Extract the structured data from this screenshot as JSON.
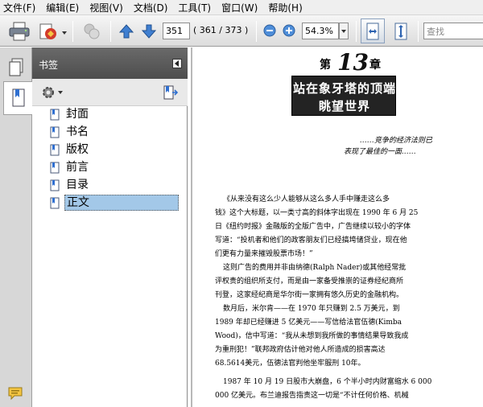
{
  "menu": [
    "文件(F)",
    "编辑(E)",
    "视图(V)",
    "文档(D)",
    "工具(T)",
    "窗口(W)",
    "帮助(H)"
  ],
  "toolbar": {
    "page_number": "351",
    "page_count": "( 361 / 373 )",
    "zoom": "54.3%",
    "search_placeholder": "查找"
  },
  "panel": {
    "title": "书签",
    "bookmarks": [
      "封面",
      "书名",
      "版权",
      "前言",
      "目录",
      "正文"
    ],
    "selected_index": 5
  },
  "document": {
    "chapter_prefix": "第",
    "chapter_number": "13",
    "chapter_suffix": "章",
    "title_lines": [
      "站在象牙塔的顶端",
      "眺望世界"
    ],
    "epigraph": [
      "……竞争的经济法则已",
      "表现了最佳的一面……"
    ],
    "paragraphs": [
      "《从来没有这么少人能够从这么多人手中赚走这么多",
      "钱》这个大标题，以一类寸高的斜体字出现在 1990 年 6 月 25",
      "日《纽约时报》金融版的全版广告中，广告继续以较小的字体",
      "写道：“投机者和他们的政客朋友们已经搞垮储贷业，现在他",
      "们更有力量来摧毁股票市场！”",
      "这则广告的费用并非由纳德(Ralph Nader)或其他经常批",
      "评权贵的组织所支付，而是由一家备受推崇的证券经纪商所",
      "刊登，这家经纪商是华尔街一家拥有悠久历史的金融机构。",
      "数月后，米尔肯——在 1970 年只赚到 2.5 万美元，到",
      "1989 年却已经赚进 5 亿美元——写信给法官伍德(Kimba",
      "Wood)，信中写道：“我从未想到我所做的事情结果导致我成",
      "为重刑犯！”联邦政府估计他对他人所造成的损害高达",
      "68.5614美元，伍德法官判他坐牢服刑 10年。",
      "1987 年 10 月 19 日股市大崩盘，6 个半小时内财富缩水 6 000",
      "000 亿美元。布兰迪报告指责这一切是“不计任何价格、机械"
    ]
  }
}
